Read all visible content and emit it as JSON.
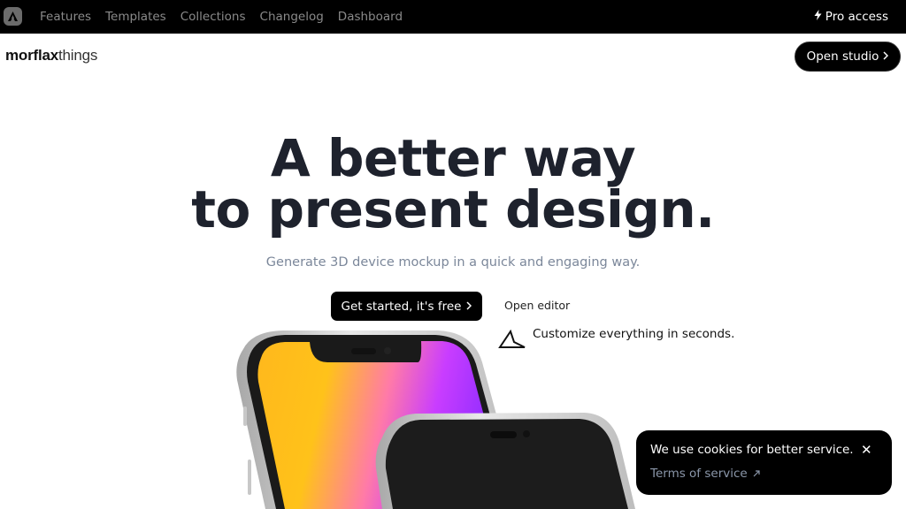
{
  "topbar": {
    "logo_icon": "morflax-logo-icon",
    "nav_items": [
      {
        "label": "Features"
      },
      {
        "label": "Templates"
      },
      {
        "label": "Collections"
      },
      {
        "label": "Changelog"
      },
      {
        "label": "Dashboard"
      }
    ],
    "pro_icon": "lightning-icon",
    "pro_label": "Pro access"
  },
  "header": {
    "brand_bold": "morflax",
    "brand_light": "things",
    "open_studio_label": "Open studio",
    "open_studio_icon": "chevron-right-icon"
  },
  "hero": {
    "headline_line1": "A better way",
    "headline_line2": "to present design.",
    "subtitle": "Generate 3D device mockup in a quick and engaging way.",
    "cta_label": "Get started, it's free",
    "cta_icon": "chevron-right-icon",
    "open_editor_label": "Open editor",
    "customize_icon": "pointer-cursor-icon",
    "customize_text": "Customize everything in seconds.",
    "screen_gradient": [
      "#ffc21a",
      "#f9a826",
      "#ff5fae",
      "#c43dff",
      "#8a2bff"
    ]
  },
  "cookie_banner": {
    "message": "We use cookies for better service.",
    "close_icon": "close-icon",
    "terms_label": "Terms of service",
    "terms_icon": "external-arrow-icon"
  },
  "colors": {
    "topbar_bg": "#000000",
    "headline": "#1e222d",
    "subtitle": "#7b879a",
    "nav_text": "#8a8a8a"
  }
}
